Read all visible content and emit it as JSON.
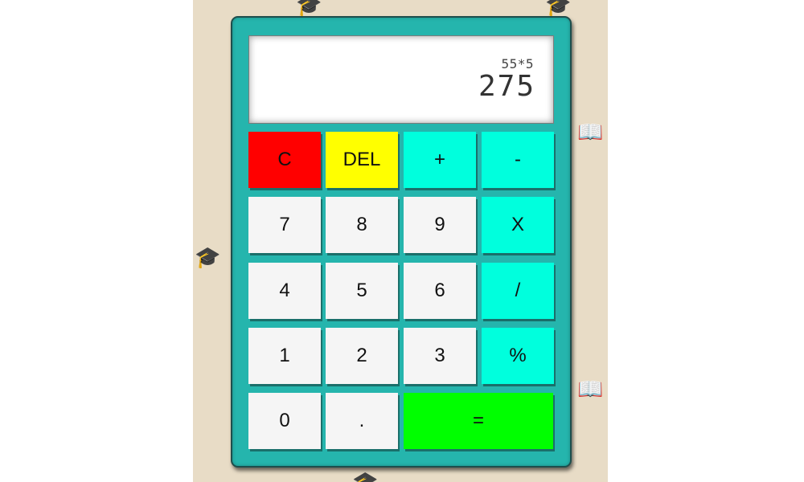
{
  "display": {
    "expression": "55*5",
    "result": "275"
  },
  "keys": {
    "clear": "C",
    "delete": "DEL",
    "add": "+",
    "subtract": "-",
    "seven": "7",
    "eight": "8",
    "nine": "9",
    "multiply": "X",
    "four": "4",
    "five": "5",
    "six": "6",
    "divide": "/",
    "one": "1",
    "two": "2",
    "three": "3",
    "percent": "%",
    "zero": "0",
    "decimal": ".",
    "equals": "="
  },
  "colors": {
    "background": "#e8dcc6",
    "body": "#25b5ad",
    "key": "#f5f5f5",
    "operator_key": "#00ffdd",
    "clear_key": "#ff0000",
    "delete_key": "#ffff00",
    "equals_key": "#00ff00"
  },
  "background_icons": [
    "graduation-cap-icon",
    "open-book-icon"
  ]
}
